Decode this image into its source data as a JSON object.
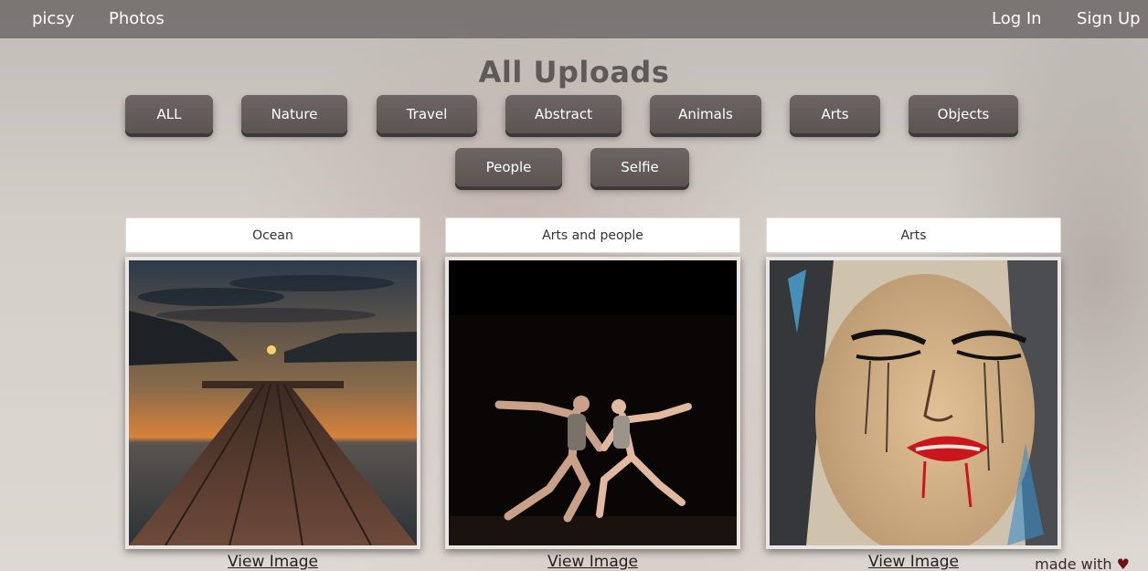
{
  "nav": {
    "brand": "picsy",
    "photos": "Photos",
    "login": "Log In",
    "signup": "Sign Up"
  },
  "page_title": "All Uploads",
  "filters": [
    "ALL",
    "Nature",
    "Travel",
    "Abstract",
    "Animals",
    "Arts",
    "Objects",
    "People",
    "Selfie"
  ],
  "cards": [
    {
      "title": "Ocean",
      "link": "View Image"
    },
    {
      "title": "Arts and people",
      "link": "View Image"
    },
    {
      "title": "Arts",
      "link": "View Image"
    }
  ],
  "footer": {
    "made_with": "made with",
    "heart_icon": "heart-icon"
  }
}
